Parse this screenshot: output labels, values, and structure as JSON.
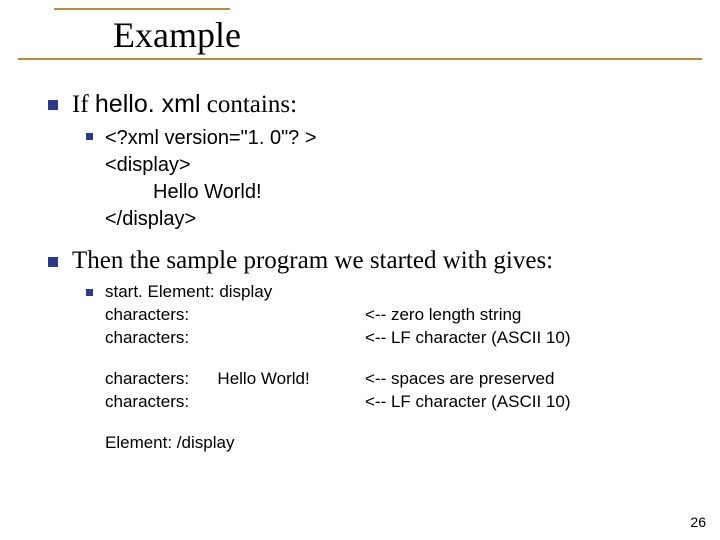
{
  "title": "Example",
  "item1": {
    "prefix": "If ",
    "filename": "hello. xml",
    "suffix": " contains:"
  },
  "code": {
    "l1": "<?xml version=\"1. 0\"? >",
    "l2": "<display>",
    "l3": "Hello World!",
    "l4": "</display>"
  },
  "item2": "Then the sample program we started with gives:",
  "out": {
    "r1_left": "start. Element: display",
    "r2_left": "characters:",
    "r2_right": "<-- zero length string",
    "r3_left": "characters:",
    "r3_right": "<-- LF character (ASCII 10)",
    "r4_left": "characters:      Hello World!",
    "r4_right": "<-- spaces are preserved",
    "r5_left": "characters:",
    "r5_right": "<-- LF character (ASCII 10)",
    "r6_left": "Element: /display"
  },
  "page": "26"
}
